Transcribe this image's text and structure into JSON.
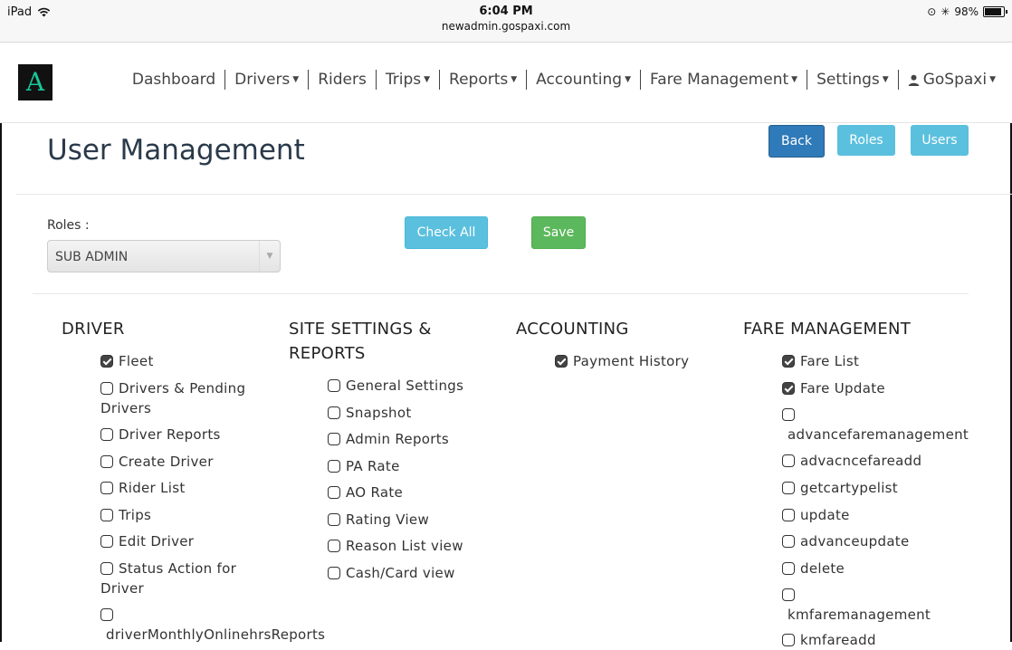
{
  "status_bar": {
    "device": "iPad",
    "time": "6:04 PM",
    "url": "newadmin.gospaxi.com",
    "battery": "98%"
  },
  "logo": {
    "text": "A"
  },
  "nav": {
    "items": [
      {
        "label": "Dashboard",
        "dropdown": false
      },
      {
        "label": "Drivers",
        "dropdown": true
      },
      {
        "label": "Riders",
        "dropdown": false
      },
      {
        "label": "Trips",
        "dropdown": true
      },
      {
        "label": "Reports",
        "dropdown": true
      },
      {
        "label": "Accounting",
        "dropdown": true
      },
      {
        "label": "Fare Management",
        "dropdown": true
      },
      {
        "label": "Settings",
        "dropdown": true
      },
      {
        "label": "GoSpaxi",
        "dropdown": true
      }
    ]
  },
  "page": {
    "title": "User Management",
    "back_label": "Back",
    "roles_label": "Roles",
    "users_label": "Users"
  },
  "form": {
    "roles_field_label": "Roles :",
    "roles_value": "SUB ADMIN",
    "check_all_label": "Check All",
    "save_label": "Save"
  },
  "columns": {
    "driver": {
      "heading": "DRIVER",
      "items": [
        {
          "label": "Fleet",
          "checked": true
        },
        {
          "label": "Drivers & Pending Drivers",
          "checked": false
        },
        {
          "label": "Driver Reports",
          "checked": false
        },
        {
          "label": "Create Driver",
          "checked": false
        },
        {
          "label": "Rider List",
          "checked": false
        },
        {
          "label": "Trips",
          "checked": false
        },
        {
          "label": "Edit Driver",
          "checked": false
        },
        {
          "label": "Status Action for Driver",
          "checked": false
        },
        {
          "label": "driverMonthlyOnlinehrsReports",
          "checked": false
        }
      ]
    },
    "site": {
      "heading": "SITE SETTINGS & REPORTS",
      "items": [
        {
          "label": "General Settings",
          "checked": false
        },
        {
          "label": "Snapshot",
          "checked": false
        },
        {
          "label": "Admin Reports",
          "checked": false
        },
        {
          "label": "PA Rate",
          "checked": false
        },
        {
          "label": "AO Rate",
          "checked": false
        },
        {
          "label": "Rating View",
          "checked": false
        },
        {
          "label": "Reason List view",
          "checked": false
        },
        {
          "label": "Cash/Card view",
          "checked": false
        }
      ]
    },
    "accounting": {
      "heading": "ACCOUNTING",
      "items": [
        {
          "label": "Payment History",
          "checked": true
        }
      ]
    },
    "fare": {
      "heading": "FARE MANAGEMENT",
      "items": [
        {
          "label": "Fare List",
          "checked": true
        },
        {
          "label": "Fare Update",
          "checked": true
        },
        {
          "label": "advancefaremanagement",
          "checked": false
        },
        {
          "label": "advacncefareadd",
          "checked": false
        },
        {
          "label": "getcartypelist",
          "checked": false
        },
        {
          "label": "update",
          "checked": false
        },
        {
          "label": "advanceupdate",
          "checked": false
        },
        {
          "label": "delete",
          "checked": false
        },
        {
          "label": "kmfaremanagement",
          "checked": false
        },
        {
          "label": "kmfareadd",
          "checked": false
        }
      ]
    }
  }
}
